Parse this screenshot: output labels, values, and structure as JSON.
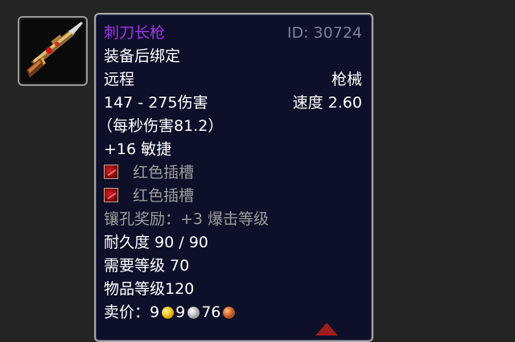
{
  "item": {
    "name": "刺刀长枪",
    "id_text": "ID: 30724",
    "binding": "装备后绑定",
    "slot": "远程",
    "weapon_type": "枪械",
    "damage": "147 - 275伤害",
    "speed": "速度 2.60",
    "dps": "（每秒伤害81.2）",
    "stat": "+16 敏捷",
    "sockets": [
      {
        "label": "红色插槽",
        "color": "#d2232a"
      },
      {
        "label": "红色插槽",
        "color": "#d2232a"
      }
    ],
    "socket_bonus": "镶孔奖励：+3 爆击等级",
    "durability": "耐久度 90 / 90",
    "required_level": "需要等级 70",
    "item_level": "物品等级120",
    "sell_price": {
      "label": "卖价：",
      "gold": "9",
      "silver": "9",
      "copper": "76"
    }
  },
  "colors": {
    "epic_name": "#a335ee",
    "tooltip_bg": "#0d1028",
    "border": "#a8a8a8",
    "id_text": "#7a7f9a",
    "gray_text": "#9d9d9d"
  },
  "icons": {
    "item_icon": "gun-weapon-icon",
    "socket_icon": "red-socket-icon",
    "gold": "gold-coin-icon",
    "silver": "silver-coin-icon",
    "copper": "copper-coin-icon"
  }
}
